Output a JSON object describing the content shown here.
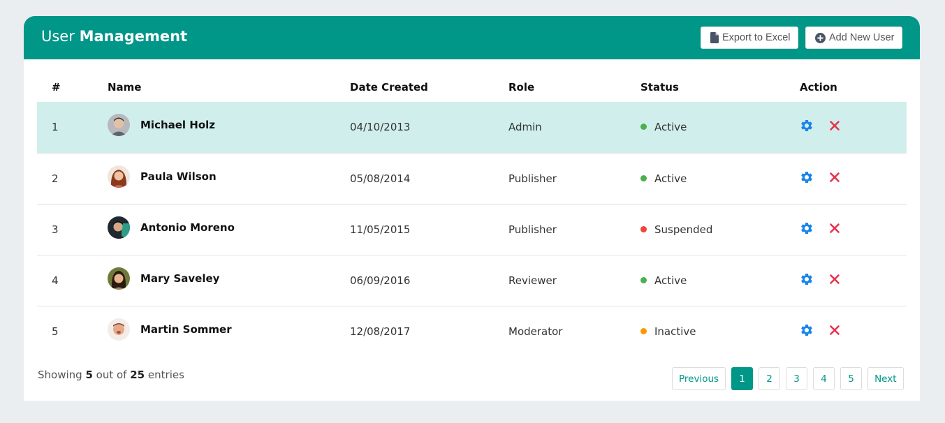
{
  "header": {
    "title_light": "User",
    "title_bold": "Management",
    "export_label": "Export to Excel",
    "add_label": "Add New User",
    "color": "#009688"
  },
  "table": {
    "columns": [
      "#",
      "Name",
      "Date Created",
      "Role",
      "Status",
      "Action"
    ],
    "rows": [
      {
        "num": "1",
        "name": "Michael Holz",
        "date": "04/10/2013",
        "role": "Admin",
        "status": "Active",
        "status_color": "#4caf50",
        "highlight": true
      },
      {
        "num": "2",
        "name": "Paula Wilson",
        "date": "05/08/2014",
        "role": "Publisher",
        "status": "Active",
        "status_color": "#4caf50",
        "highlight": false
      },
      {
        "num": "3",
        "name": "Antonio Moreno",
        "date": "11/05/2015",
        "role": "Publisher",
        "status": "Suspended",
        "status_color": "#f44336",
        "highlight": false
      },
      {
        "num": "4",
        "name": "Mary Saveley",
        "date": "06/09/2016",
        "role": "Reviewer",
        "status": "Active",
        "status_color": "#4caf50",
        "highlight": false
      },
      {
        "num": "5",
        "name": "Martin Sommer",
        "date": "12/08/2017",
        "role": "Moderator",
        "status": "Inactive",
        "status_color": "#ff9800",
        "highlight": false
      }
    ],
    "action_icons": [
      "gear-icon",
      "close-icon"
    ]
  },
  "footer": {
    "showing_prefix": "Showing",
    "shown": "5",
    "out_of": "out of",
    "total": "25",
    "entries": "entries"
  },
  "pagination": {
    "previous": "Previous",
    "pages": [
      "1",
      "2",
      "3",
      "4",
      "5"
    ],
    "active_page": "1",
    "next": "Next"
  }
}
